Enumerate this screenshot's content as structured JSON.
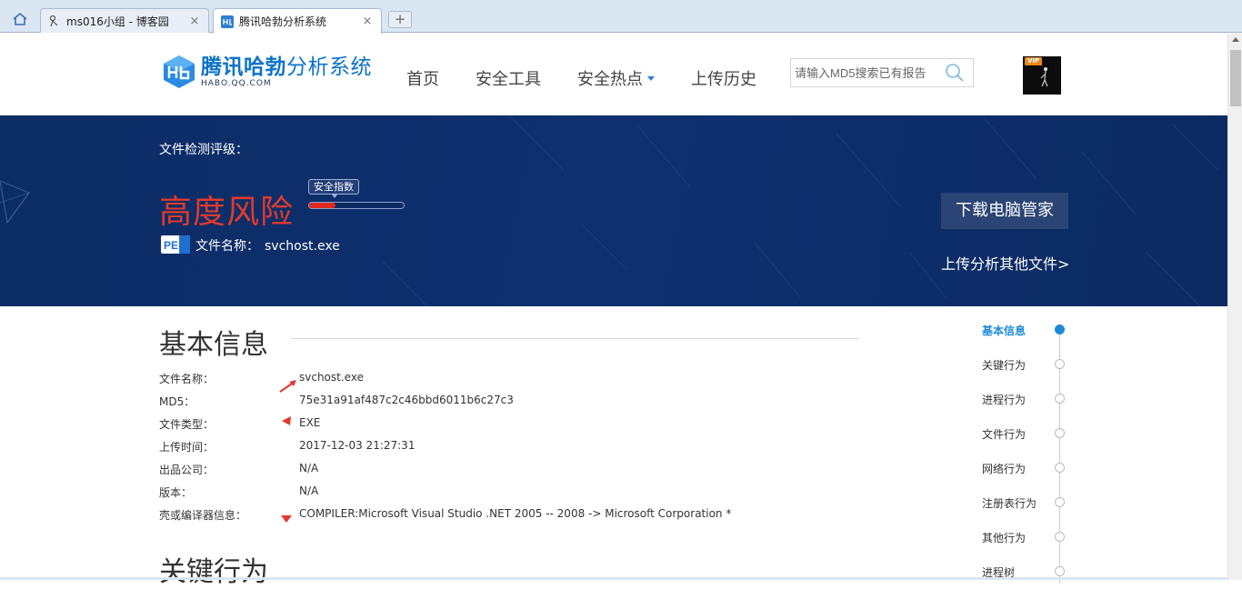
{
  "browser": {
    "tabs": [
      {
        "title": "ms016小组 - 博客园",
        "close": "×",
        "active": false
      },
      {
        "title": "腾讯哈勃分析系统",
        "close": "×",
        "active": true
      }
    ],
    "new_tab": "+"
  },
  "header": {
    "logo_cn_bold": "腾讯哈勃",
    "logo_cn_thin": "分析系统",
    "logo_en": "HABO.QQ.COM",
    "nav": [
      "首页",
      "安全工具",
      "安全热点",
      "上传历史"
    ],
    "search_placeholder": "请输入MD5搜索已有报告",
    "avatar_badge": "VIP"
  },
  "banner": {
    "rating_label": "文件检测评级：",
    "risk_level": "高度风险",
    "score_tip": "安全指数",
    "score_fraction": 0.28,
    "file_icon_text": "PE",
    "filename_label": "文件名称：",
    "filename_value": "svchost.exe",
    "download_button": "下载电脑管家",
    "upload_link": "上传分析其他文件>"
  },
  "basic_info": {
    "title": "基本信息",
    "rows": [
      {
        "key": "文件名称：",
        "value": "svchost.exe"
      },
      {
        "key": "MD5：",
        "value": "75e31a91af487c2c46bbd6011b6c27c3"
      },
      {
        "key": "文件类型：",
        "value": "EXE"
      },
      {
        "key": "上传时间：",
        "value": "2017-12-03 21:27:31"
      },
      {
        "key": "出品公司：",
        "value": "N/A"
      },
      {
        "key": "版本：",
        "value": "N/A"
      },
      {
        "key": "壳或编译器信息：",
        "value": "COMPILER:Microsoft Visual Studio .NET 2005 -- 2008 -> Microsoft Corporation *"
      }
    ]
  },
  "key_behavior": {
    "title": "关键行为"
  },
  "sidenav": {
    "items": [
      {
        "label": "基本信息",
        "active": true
      },
      {
        "label": "关键行为",
        "active": false
      },
      {
        "label": "进程行为",
        "active": false
      },
      {
        "label": "文件行为",
        "active": false
      },
      {
        "label": "网络行为",
        "active": false
      },
      {
        "label": "注册表行为",
        "active": false
      },
      {
        "label": "其他行为",
        "active": false
      },
      {
        "label": "进程树",
        "active": false
      }
    ]
  },
  "colors": {
    "brand_blue": "#0c72c9",
    "banner_bg": "#0e3070",
    "risk_red": "#e03a2c",
    "active_blue": "#1c8ad8"
  }
}
